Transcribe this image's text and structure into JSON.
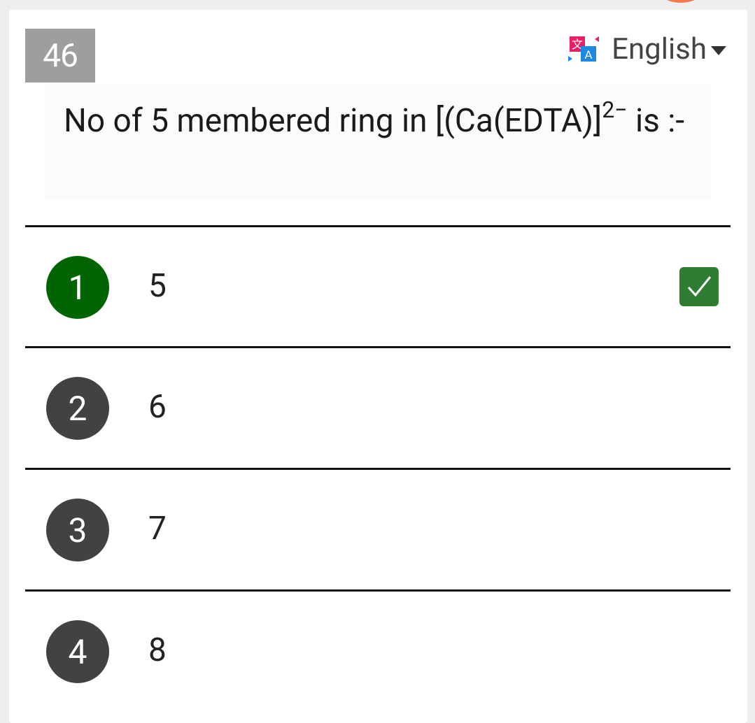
{
  "question": {
    "number": "46",
    "text_main": "No of 5 membered ring in [(Ca(EDTA)]",
    "text_sup": "2−",
    "text_tail": " is :-"
  },
  "language": {
    "label": "English",
    "icon": "translate-icon"
  },
  "options": [
    {
      "num": "1",
      "value": "5",
      "correct": true
    },
    {
      "num": "2",
      "value": "6",
      "correct": false
    },
    {
      "num": "3",
      "value": "7",
      "correct": false
    },
    {
      "num": "4",
      "value": "8",
      "correct": false
    }
  ],
  "colors": {
    "correct_badge": "#006400",
    "checkbox": "#2e7d32",
    "option_badge": "#424242",
    "number_box": "#9e9e9e",
    "accent_dot": "#f47a4c"
  }
}
